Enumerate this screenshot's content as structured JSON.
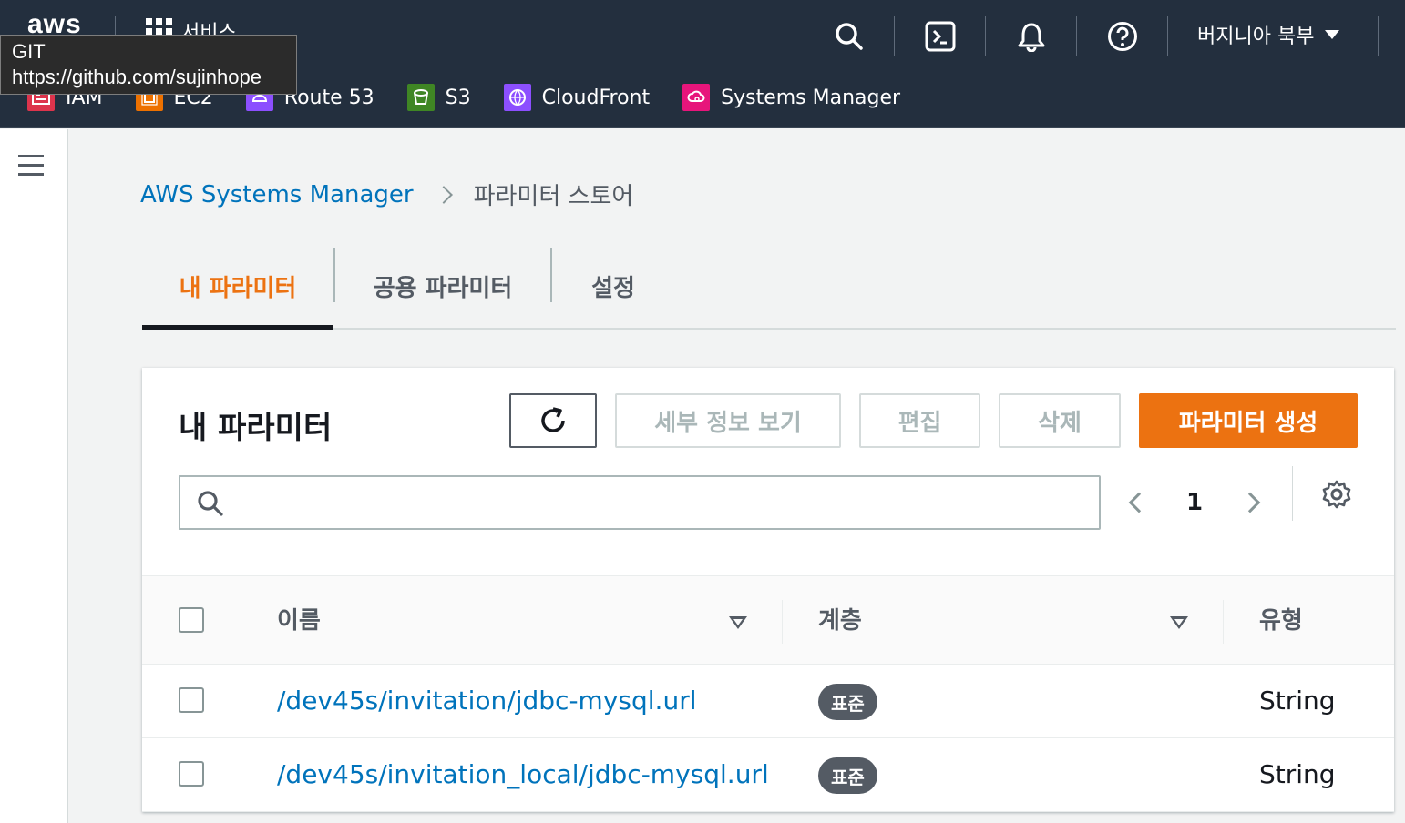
{
  "topnav": {
    "logo": "aws",
    "services_label": "서비스",
    "region": "버지니아 북부",
    "icons": [
      "search-icon",
      "cloudshell-icon",
      "bell-icon",
      "help-icon"
    ]
  },
  "tooltip": {
    "line1": "GIT",
    "line2": "https://github.com/sujinhope"
  },
  "favorites": [
    {
      "label": "IAM",
      "icon": "iam-icon",
      "color": "#dd344c"
    },
    {
      "label": "EC2",
      "icon": "ec2-icon",
      "color": "#ed7100"
    },
    {
      "label": "Route 53",
      "icon": "route53-icon",
      "color": "#8c4fff"
    },
    {
      "label": "S3",
      "icon": "s3-icon",
      "color": "#3f8624"
    },
    {
      "label": "CloudFront",
      "icon": "cloudfront-icon",
      "color": "#8c4fff"
    },
    {
      "label": "Systems Manager",
      "icon": "systems-manager-icon",
      "color": "#e7157b"
    }
  ],
  "breadcrumb": {
    "parent": "AWS Systems Manager",
    "current": "파라미터 스토어"
  },
  "tabs": [
    {
      "label": "내 파라미터",
      "active": true
    },
    {
      "label": "공용 파라미터",
      "active": false
    },
    {
      "label": "설정",
      "active": false
    }
  ],
  "panel": {
    "title": "내 파라미터",
    "buttons": {
      "details": "세부 정보 보기",
      "edit": "편집",
      "delete": "삭제",
      "create": "파라미터 생성"
    },
    "search_value": "",
    "page": "1"
  },
  "table": {
    "columns": [
      "이름",
      "계층",
      "유형"
    ],
    "rows": [
      {
        "name": "/dev45s/invitation/jdbc-mysql.url",
        "tier": "표준",
        "type": "String"
      },
      {
        "name": "/dev45s/invitation_local/jdbc-mysql.url",
        "tier": "표준",
        "type": "String"
      }
    ]
  },
  "colors": {
    "nav_bg": "#232f3e",
    "accent": "#ec7211",
    "link": "#0073bb"
  }
}
